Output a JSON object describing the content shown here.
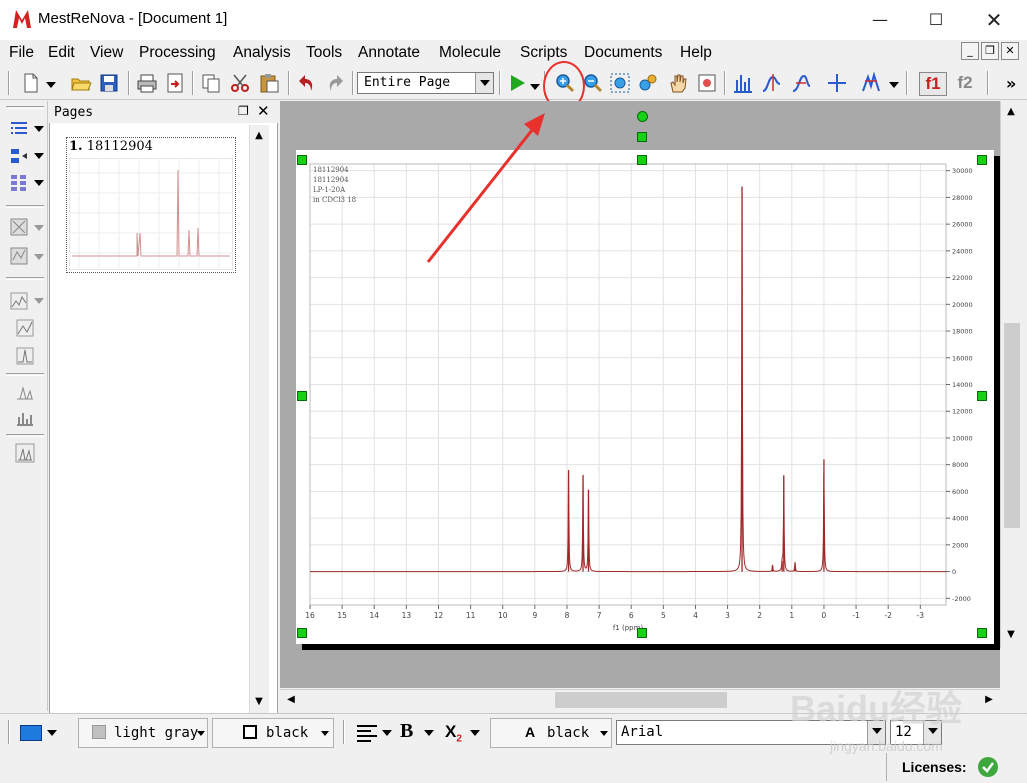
{
  "window": {
    "title": "MestReNova - [Document 1]"
  },
  "menubar": [
    "File",
    "Edit",
    "View",
    "Processing",
    "Analysis",
    "Tools",
    "Annotate",
    "Molecule",
    "Scripts",
    "Documents",
    "Help"
  ],
  "toolbar": {
    "view_mode": "Entire Page",
    "highlighted_tool": "zoom-in",
    "f1_label": "f1",
    "f2_label": "f2",
    "overflow": "»"
  },
  "pages_panel": {
    "title": "Pages",
    "pages": [
      {
        "number": "1.",
        "name": "18112904"
      }
    ]
  },
  "spectrum": {
    "header_lines": [
      "18112904",
      "18112904",
      "LP-1-20A",
      "in CDCl3 18"
    ],
    "x_axis_label": "f1 (ppm)",
    "colors": {
      "trace": "#a02828",
      "grid": "#e2e2e2",
      "handle": "#17d117",
      "annotation": "#e8302c"
    },
    "chart_data": {
      "type": "line",
      "xlabel": "f1 (ppm)",
      "ylabel": "",
      "xlim": [
        16.0,
        -3.8
      ],
      "ylim": [
        -2500,
        30500
      ],
      "x_ticks": [
        16,
        15,
        14,
        13,
        12,
        11,
        10,
        9,
        8,
        7,
        6,
        5,
        4,
        3,
        2,
        1,
        0,
        -1,
        -2,
        -3
      ],
      "y_ticks": [
        30000,
        28000,
        26000,
        24000,
        22000,
        20000,
        18000,
        16000,
        14000,
        12000,
        10000,
        8000,
        6000,
        4000,
        2000,
        0,
        -2000
      ],
      "peaks": [
        {
          "ppm": 7.95,
          "height": 7600
        },
        {
          "ppm": 7.5,
          "height": 7200
        },
        {
          "ppm": 7.33,
          "height": 6100
        },
        {
          "ppm": 2.55,
          "height": 28800
        },
        {
          "ppm": 1.6,
          "height": 500
        },
        {
          "ppm": 1.3,
          "height": 800
        },
        {
          "ppm": 1.25,
          "height": 7200
        },
        {
          "ppm": 0.9,
          "height": 700
        },
        {
          "ppm": 0.0,
          "height": 8400
        }
      ]
    }
  },
  "format_bar": {
    "fill_color_label": "light gray",
    "line_color_label": "black",
    "bold_label": "B",
    "subscript_label": "X",
    "subscript_index": "2",
    "font_color_glyph": "A",
    "font_color_label": "black",
    "font_name": "Arial",
    "font_size": "12"
  },
  "status": {
    "licenses_label": "Licenses:"
  },
  "watermark": {
    "brand": "Baidu经验",
    "domain": "jingyan.baidu.com"
  }
}
